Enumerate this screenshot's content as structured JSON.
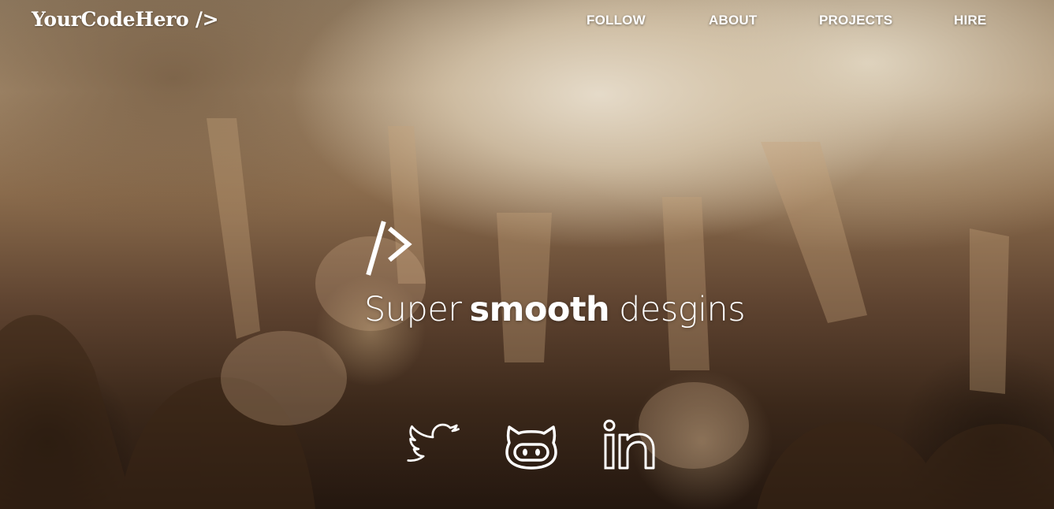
{
  "brand": {
    "logo_text": "YourCodeHero />"
  },
  "nav": {
    "items": [
      {
        "label": "FOLLOW"
      },
      {
        "label": "ABOUT"
      },
      {
        "label": "PROJECTS"
      },
      {
        "label": "HIRE"
      }
    ]
  },
  "hero": {
    "mark_icon": "code-slash-chevron-icon",
    "tagline_start": "Super",
    "tagline_emphasis": "smooth",
    "tagline_end": "desgins"
  },
  "social": [
    {
      "icon": "twitter-icon"
    },
    {
      "icon": "github-icon"
    },
    {
      "icon": "linkedin-icon"
    }
  ],
  "colors": {
    "text": "#ffffff",
    "background_tone": "#8a6b4c"
  }
}
